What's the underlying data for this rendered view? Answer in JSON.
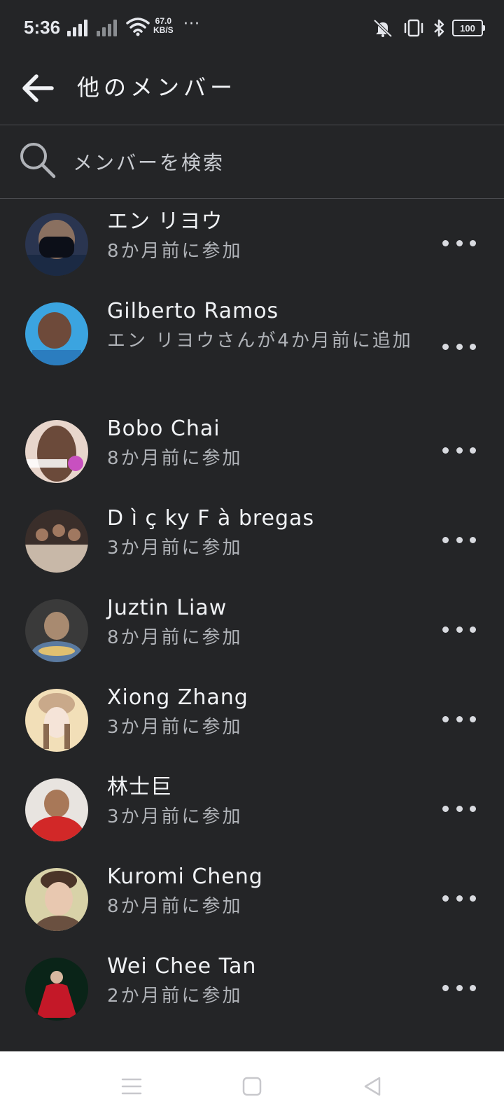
{
  "status_bar": {
    "time": "5:36",
    "speed_value": "67.0",
    "speed_unit": "KB/S",
    "more": "···",
    "battery": "100"
  },
  "header": {
    "title": "他のメンバー"
  },
  "search": {
    "placeholder": "メンバーを検索"
  },
  "members": [
    {
      "name": "エン リヨウ",
      "sub": "8か月前に参加",
      "avatar_colors": [
        "#2a3550",
        "#0c0f18"
      ]
    },
    {
      "name": "Gilberto Ramos",
      "sub": "エン リヨウさんが4か月前に追加",
      "avatar_colors": [
        "#3ba4e0",
        "#6e4a3a"
      ]
    },
    {
      "name": "Bobo Chai",
      "sub": "8か月前に参加",
      "avatar_colors": [
        "#e8d6cc",
        "#6b4a3a"
      ]
    },
    {
      "name": "D ì ç ky F à bregas",
      "sub": "3か月前に参加",
      "avatar_colors": [
        "#3a2e2a",
        "#c8b8a8"
      ]
    },
    {
      "name": "Juztin Liaw",
      "sub": "8か月前に参加",
      "avatar_colors": [
        "#3a3a3a",
        "#a88a70"
      ]
    },
    {
      "name": "Xiong Zhang",
      "sub": "3か月前に参加",
      "avatar_colors": [
        "#f2dfb8",
        "#c9a98a"
      ]
    },
    {
      "name": "林士巨",
      "sub": "3か月前に参加",
      "avatar_colors": [
        "#e8e4e0",
        "#d22828"
      ]
    },
    {
      "name": "Kuromi Cheng",
      "sub": "8か月前に参加",
      "avatar_colors": [
        "#d8d2a8",
        "#6a5040"
      ]
    },
    {
      "name": "Wei Chee Tan",
      "sub": "2か月前に参加",
      "avatar_colors": [
        "#0a2418",
        "#c41828"
      ]
    }
  ],
  "nav": {
    "icons": [
      "menu-icon",
      "home-square-icon",
      "back-triangle-icon"
    ]
  }
}
